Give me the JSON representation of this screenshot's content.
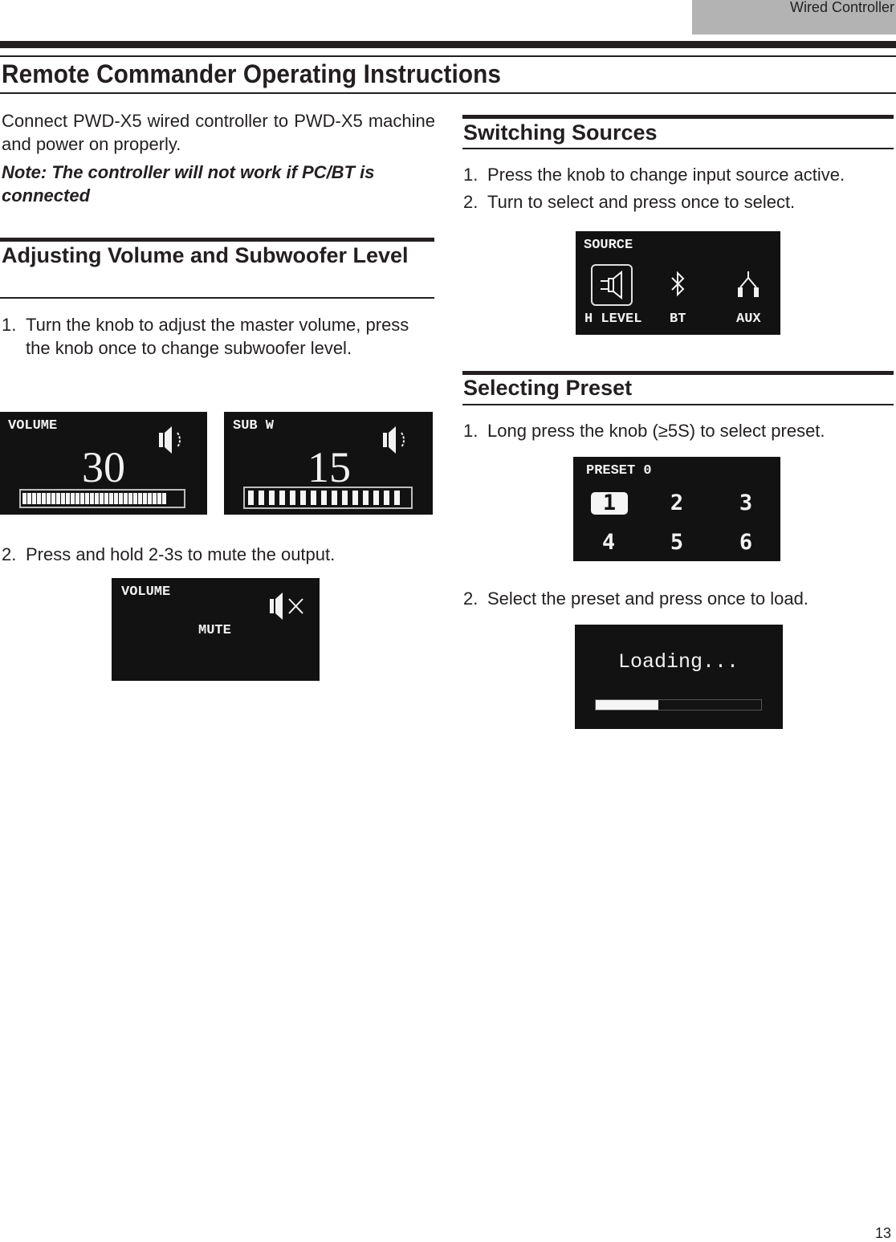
{
  "header": {
    "section_tab": "Wired Controller",
    "page_title": "Remote Commander Operating Instructions",
    "page_number": "13"
  },
  "intro": {
    "text": "Connect PWD-X5 wired controller to PWD-X5 machine and power on properly.",
    "note": "Note: The controller will not work if PC/BT is connected"
  },
  "volume_section": {
    "title": "Adjusting Volume and Subwoofer Level",
    "steps": [
      {
        "num": "1.",
        "text": "Turn the knob to adjust the master volume, press the knob once to change subwoofer level."
      },
      {
        "num": "2.",
        "text": "Press and hold 2-3s to mute the output."
      }
    ],
    "screens": {
      "volume": {
        "label": "VOLUME",
        "value": "30",
        "icon": "speaker-on-icon",
        "bar_fill_fraction": 0.85,
        "bar_segments_filled": 30
      },
      "sub": {
        "label": "SUB W",
        "value": "15",
        "icon": "speaker-on-icon",
        "bar_fill_fraction": 1.0,
        "bar_segments_filled": 15
      },
      "mute": {
        "label": "VOLUME",
        "value": "MUTE",
        "icon": "speaker-muted-icon"
      }
    }
  },
  "source_section": {
    "title": "Switching Sources",
    "steps": [
      {
        "num": "1.",
        "text": "Press the knob to change input source active."
      },
      {
        "num": "2.",
        "text": "Turn to select and press once to select."
      }
    ],
    "screen": {
      "label": "SOURCE",
      "sources": [
        {
          "label": "H LEVEL",
          "icon": "speaker-input-icon",
          "selected": true
        },
        {
          "label": "BT",
          "icon": "bluetooth-icon",
          "selected": false
        },
        {
          "label": "AUX",
          "icon": "rca-aux-icon",
          "selected": false
        }
      ]
    }
  },
  "preset_section": {
    "title": "Selecting Preset",
    "steps": [
      {
        "num": "1.",
        "text": "Long press the knob (≥5S) to select preset."
      },
      {
        "num": "2.",
        "text": "Select the preset and press once to load."
      }
    ],
    "preset_screen": {
      "label": "PRESET 0",
      "presets": [
        "1",
        "2",
        "3",
        "4",
        "5",
        "6"
      ],
      "selected": "1"
    },
    "loading_screen": {
      "label": "Loading...",
      "progress_fraction": 0.38
    }
  }
}
